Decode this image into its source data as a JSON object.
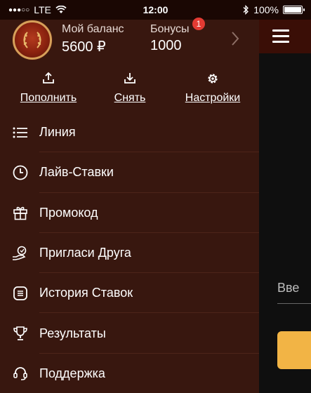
{
  "status_bar": {
    "signal": "●●●○○",
    "carrier": "LTE",
    "time": "12:00",
    "battery_percent": "100%"
  },
  "profile": {
    "balance_label": "Мой баланс",
    "balance_value": "5600 ₽",
    "bonus_label": "Бонусы",
    "bonus_value": "1000",
    "bonus_badge": "1"
  },
  "actions": [
    {
      "label": "Пополнить",
      "icon": "upload-icon"
    },
    {
      "label": "Снять",
      "icon": "download-icon"
    },
    {
      "label": "Настройки",
      "icon": "gear-icon"
    }
  ],
  "menu": [
    {
      "label": "Линия",
      "icon": "list-icon"
    },
    {
      "label": "Лайв-Ставки",
      "icon": "clock-icon"
    },
    {
      "label": "Промокод",
      "icon": "gift-icon"
    },
    {
      "label": "Пригласи Друга",
      "icon": "invite-friend-icon"
    },
    {
      "label": "История Ставок",
      "icon": "history-icon"
    },
    {
      "label": "Результаты",
      "icon": "trophy-icon"
    },
    {
      "label": "Поддержка",
      "icon": "headset-icon"
    }
  ],
  "background": {
    "input_placeholder_partial": "Вве"
  },
  "colors": {
    "drawer_bg": "#38170f",
    "accent_yellow": "#f2b445",
    "badge_red": "#e33b33"
  }
}
